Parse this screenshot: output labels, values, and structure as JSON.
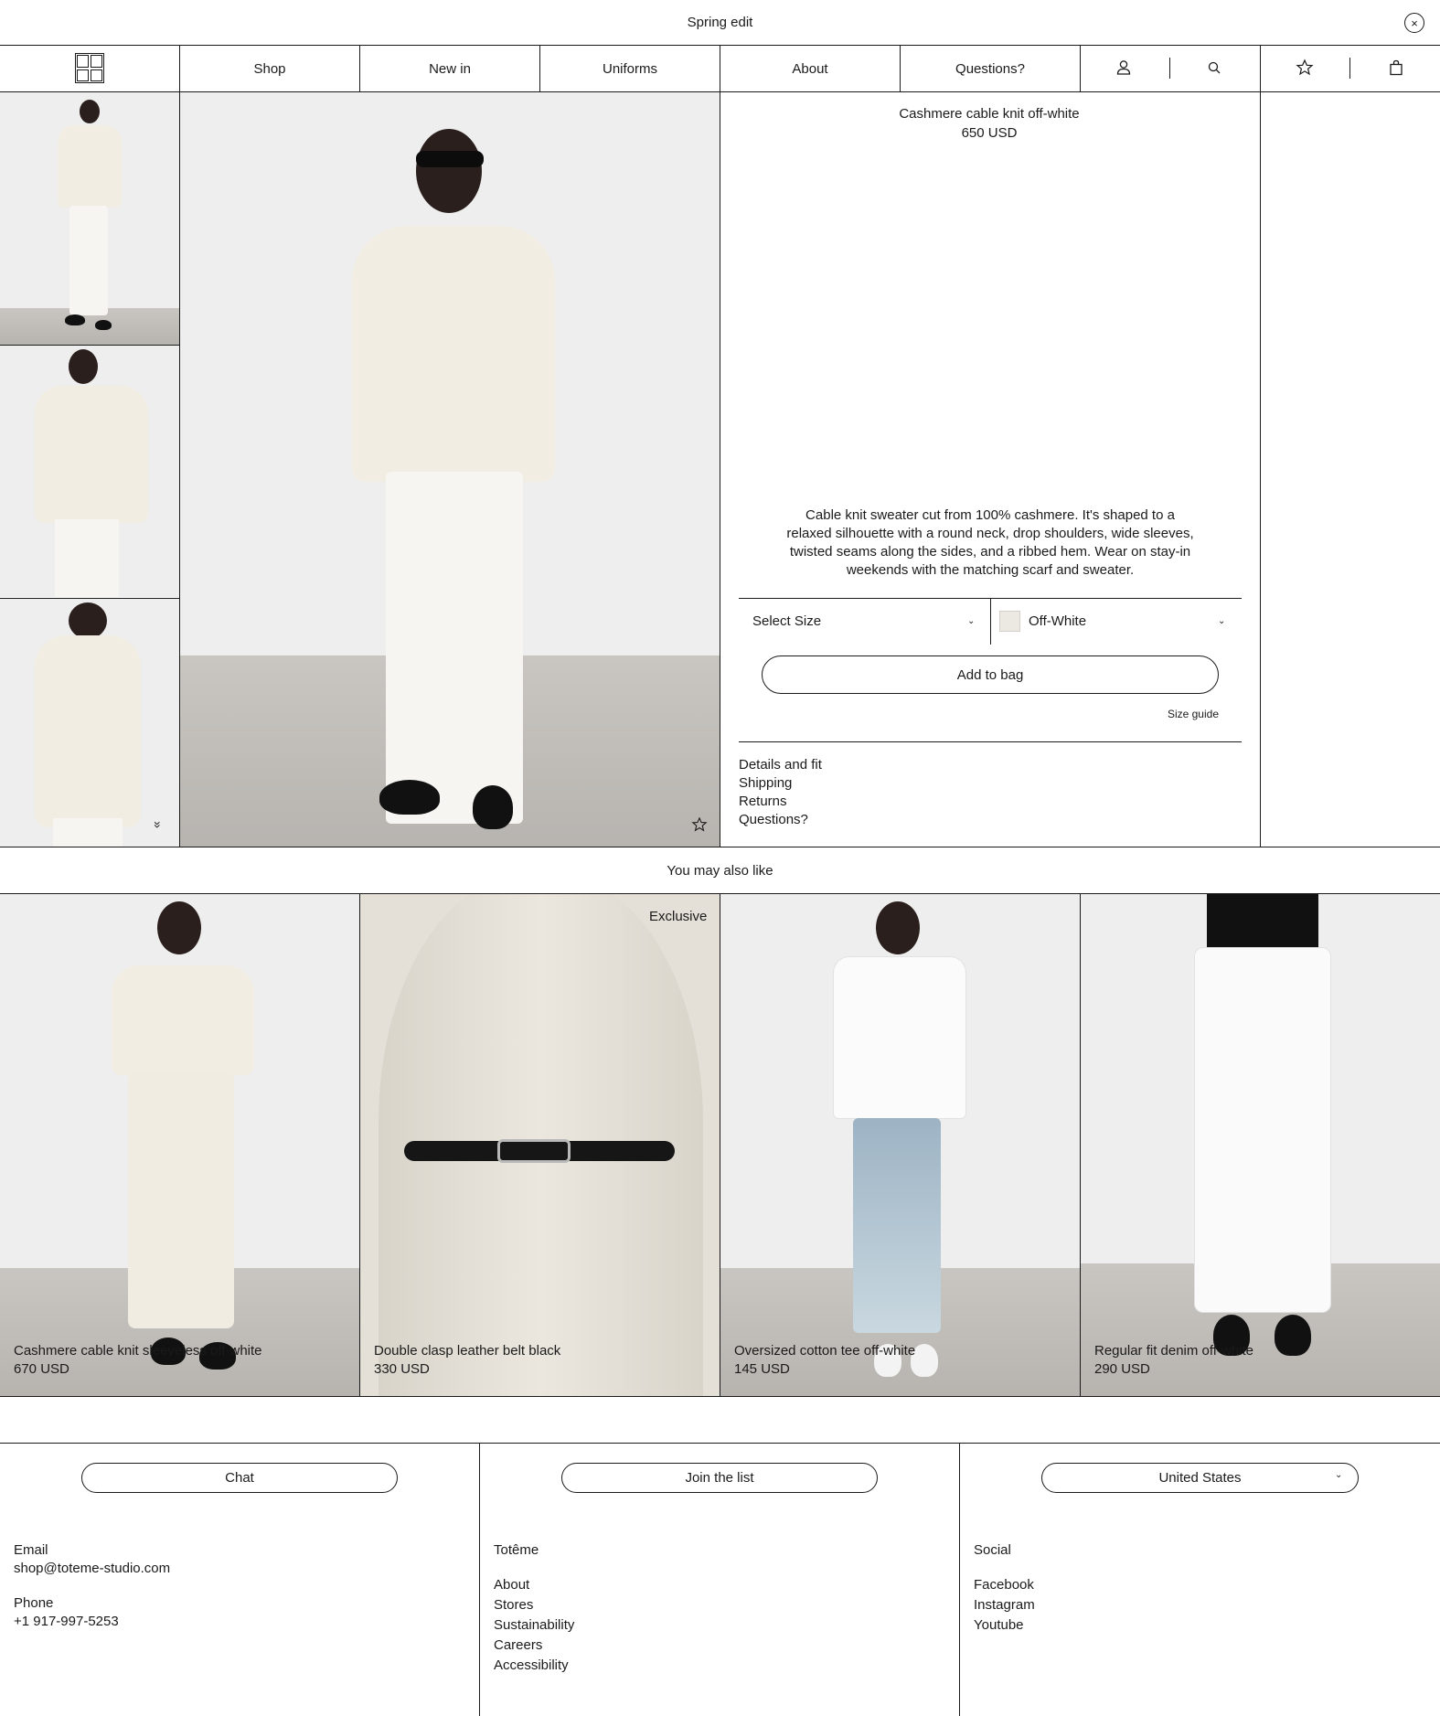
{
  "announcement": {
    "text": "Spring edit",
    "close_icon": "×"
  },
  "nav": {
    "items": [
      "Shop",
      "New in",
      "Uniforms",
      "About",
      "Questions?"
    ],
    "icons": {
      "account": "account-icon",
      "search": "search-icon",
      "wishlist": "star-icon",
      "bag": "bag-icon"
    }
  },
  "product": {
    "name": "Cashmere cable knit off-white",
    "price": "650 USD",
    "description": "Cable knit sweater cut from 100% cashmere. It's shaped to a relaxed silhouette with a round neck, drop shoulders, wide sleeves, twisted seams along the sides, and a ribbed hem. Wear on stay-in weekends with the matching scarf and sweater.",
    "size_select": "Select Size",
    "color_select": "Off-White",
    "add_to_bag": "Add to bag",
    "size_guide": "Size guide",
    "accordion": [
      "Details and fit",
      "Shipping",
      "Returns",
      "Questions?"
    ],
    "thumb_scroll_icon": "»",
    "wishlist_icon": "☆"
  },
  "recs": {
    "title": "You may also like",
    "items": [
      {
        "name": "Cashmere cable knit sleeveless off-white",
        "price": "670 USD",
        "badge": ""
      },
      {
        "name": "Double clasp leather belt black",
        "price": "330 USD",
        "badge": "Exclusive"
      },
      {
        "name": "Oversized cotton tee off-white",
        "price": "145 USD",
        "badge": ""
      },
      {
        "name": "Regular fit denim off-white",
        "price": "290 USD",
        "badge": ""
      }
    ]
  },
  "footer": {
    "chat": "Chat",
    "join": "Join the list",
    "country": "United States",
    "contact": {
      "email_label": "Email",
      "email": "shop@toteme-studio.com",
      "phone_label": "Phone",
      "phone": "+1 917-997-5253"
    },
    "brand": {
      "title": "Totême",
      "links": [
        "About",
        "Stores",
        "Sustainability",
        "Careers",
        "Accessibility"
      ]
    },
    "social": {
      "title": "Social",
      "links": [
        "Facebook",
        "Instagram",
        "Youtube"
      ]
    }
  }
}
